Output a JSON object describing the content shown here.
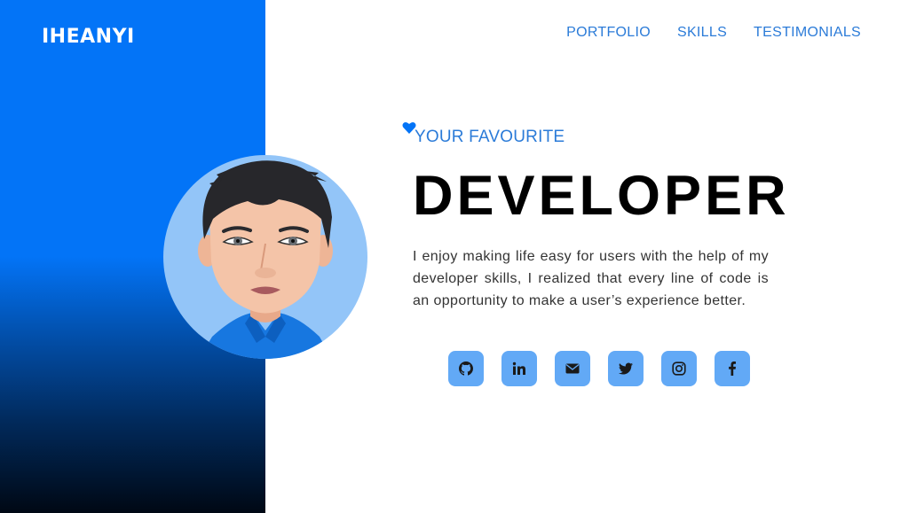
{
  "brand": {
    "logo_text": "IHEANYI"
  },
  "nav": {
    "items": [
      {
        "label": "PORTFOLIO"
      },
      {
        "label": "SKILLS"
      },
      {
        "label": "TESTIMONIALS"
      }
    ]
  },
  "hero": {
    "eyebrow": "YOUR FAVOURITE",
    "headline": "DEVELOPER",
    "bio": "I enjoy making life easy for users with the help of my developer skills, I realized that every line of code is an opportunity to make a user’s experience better."
  },
  "socials": [
    {
      "icon": "github-icon"
    },
    {
      "icon": "linkedin-icon"
    },
    {
      "icon": "email-icon"
    },
    {
      "icon": "twitter-icon"
    },
    {
      "icon": "instagram-icon"
    },
    {
      "icon": "facebook-icon"
    }
  ],
  "colors": {
    "accent": "#0374f7",
    "nav_link": "#2b7bd8",
    "social_bg": "#62a9f6",
    "avatar_bg": "#93c5f8"
  }
}
